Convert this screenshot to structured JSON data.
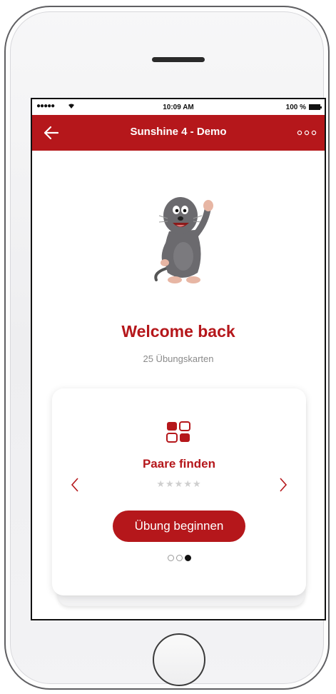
{
  "status": {
    "signal": "●●●●●",
    "time": "10:09 AM",
    "battery": "100 %"
  },
  "nav": {
    "title": "Sunshine 4 - Demo",
    "back_icon": "arrow-left-icon",
    "more_icon": "more-dots-icon"
  },
  "main": {
    "welcome": "Welcome back",
    "count_label": "25 Übungskarten"
  },
  "card": {
    "title": "Paare finden",
    "rating_stars": "★★★★★",
    "rating": 0,
    "start_label": "Übung beginnen",
    "page_index": 3,
    "page_count": 3
  },
  "colors": {
    "brand": "#b5171b",
    "muted": "#8a8a8a"
  }
}
